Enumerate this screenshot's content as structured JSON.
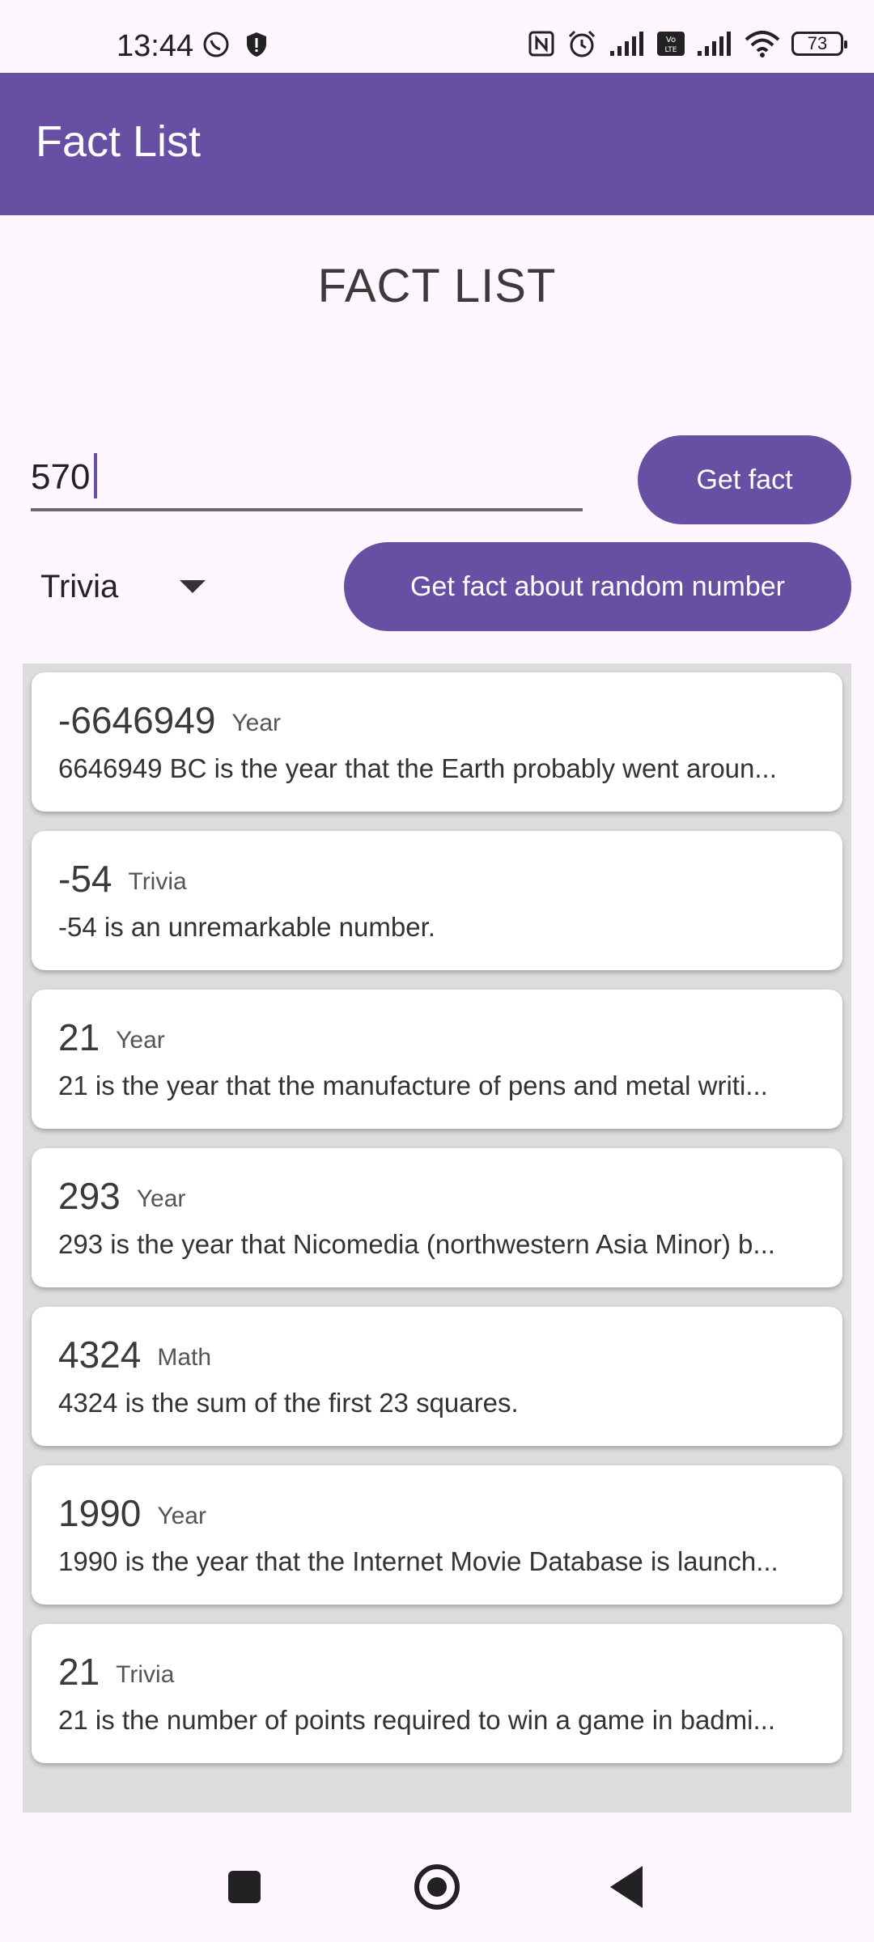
{
  "status_bar": {
    "time": "13:44",
    "battery": "73",
    "left_icons": [
      "viber-icon",
      "shield-alert-icon"
    ],
    "right_icons": [
      "nfc-icon",
      "alarm-icon",
      "signal-icon",
      "volte-icon",
      "signal-icon",
      "wifi-icon"
    ]
  },
  "app_bar": {
    "title": "Fact List"
  },
  "page_title": "FACT LIST",
  "input": {
    "value": "570"
  },
  "buttons": {
    "get_fact": "Get fact",
    "random": "Get fact about random number"
  },
  "dropdown": {
    "selected": "Trivia"
  },
  "facts": [
    {
      "number": "-6646949",
      "category": "Year",
      "text": "6646949 BC is the year that the Earth probably went aroun..."
    },
    {
      "number": "-54",
      "category": "Trivia",
      "text": "-54 is an unremarkable number."
    },
    {
      "number": "21",
      "category": "Year",
      "text": "21 is the year that the manufacture of pens and metal writi..."
    },
    {
      "number": "293",
      "category": "Year",
      "text": "293 is the year that Nicomedia (northwestern Asia Minor) b..."
    },
    {
      "number": "4324",
      "category": "Math",
      "text": "4324 is the sum of the first 23 squares."
    },
    {
      "number": "1990",
      "category": "Year",
      "text": "1990 is the year that the Internet Movie Database is launch..."
    },
    {
      "number": "21",
      "category": "Trivia",
      "text": "21 is the number of points required to win a game in badmi..."
    }
  ],
  "colors": {
    "primary": "#6750A4",
    "background": "#FEF7FF",
    "list_bg": "#DCDCDC"
  }
}
